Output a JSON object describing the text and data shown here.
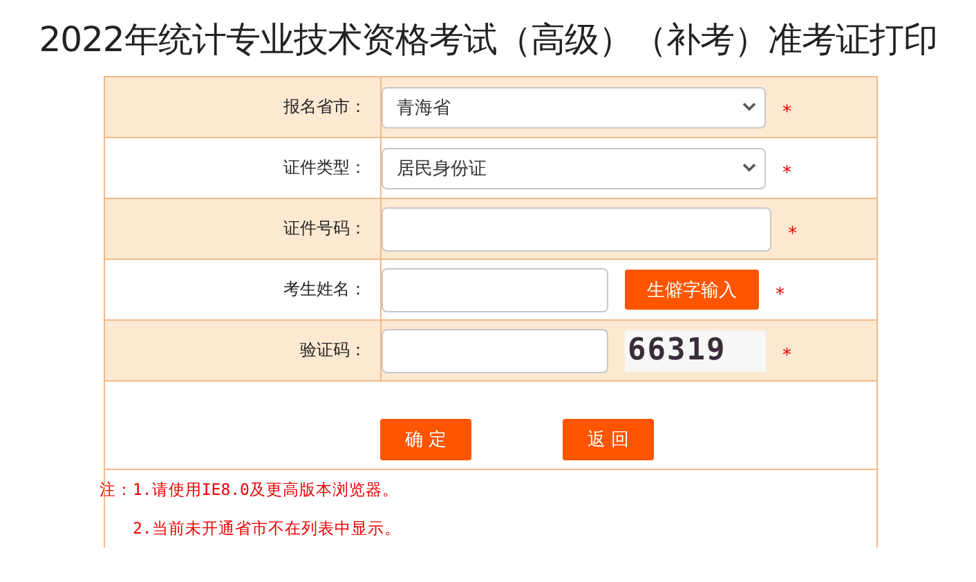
{
  "title": "2022年统计专业技术资格考试（高级）（补考）准考证打印",
  "rows": [
    {
      "label": "报名省市：",
      "kind": "select",
      "value": "青海省",
      "required_mark": "*",
      "shaded": true
    },
    {
      "label": "证件类型：",
      "kind": "select",
      "value": "居民身份证",
      "required_mark": "*",
      "shaded": false
    },
    {
      "label": "证件号码：",
      "kind": "input",
      "required_mark": "*",
      "shaded": true
    },
    {
      "label": "考生姓名：",
      "kind": "input_button",
      "button": "生僻字输入",
      "required_mark": "*",
      "shaded": false
    },
    {
      "label": "验证码：",
      "kind": "captcha",
      "captcha": "66319",
      "required_mark": "*",
      "shaded": true
    }
  ],
  "buttons": [
    "确 定",
    "返 回"
  ],
  "notes": [
    "注：1.请使用IE8.0及更高版本浏览器。",
    "2.当前未开通省市不在列表中显示。"
  ]
}
